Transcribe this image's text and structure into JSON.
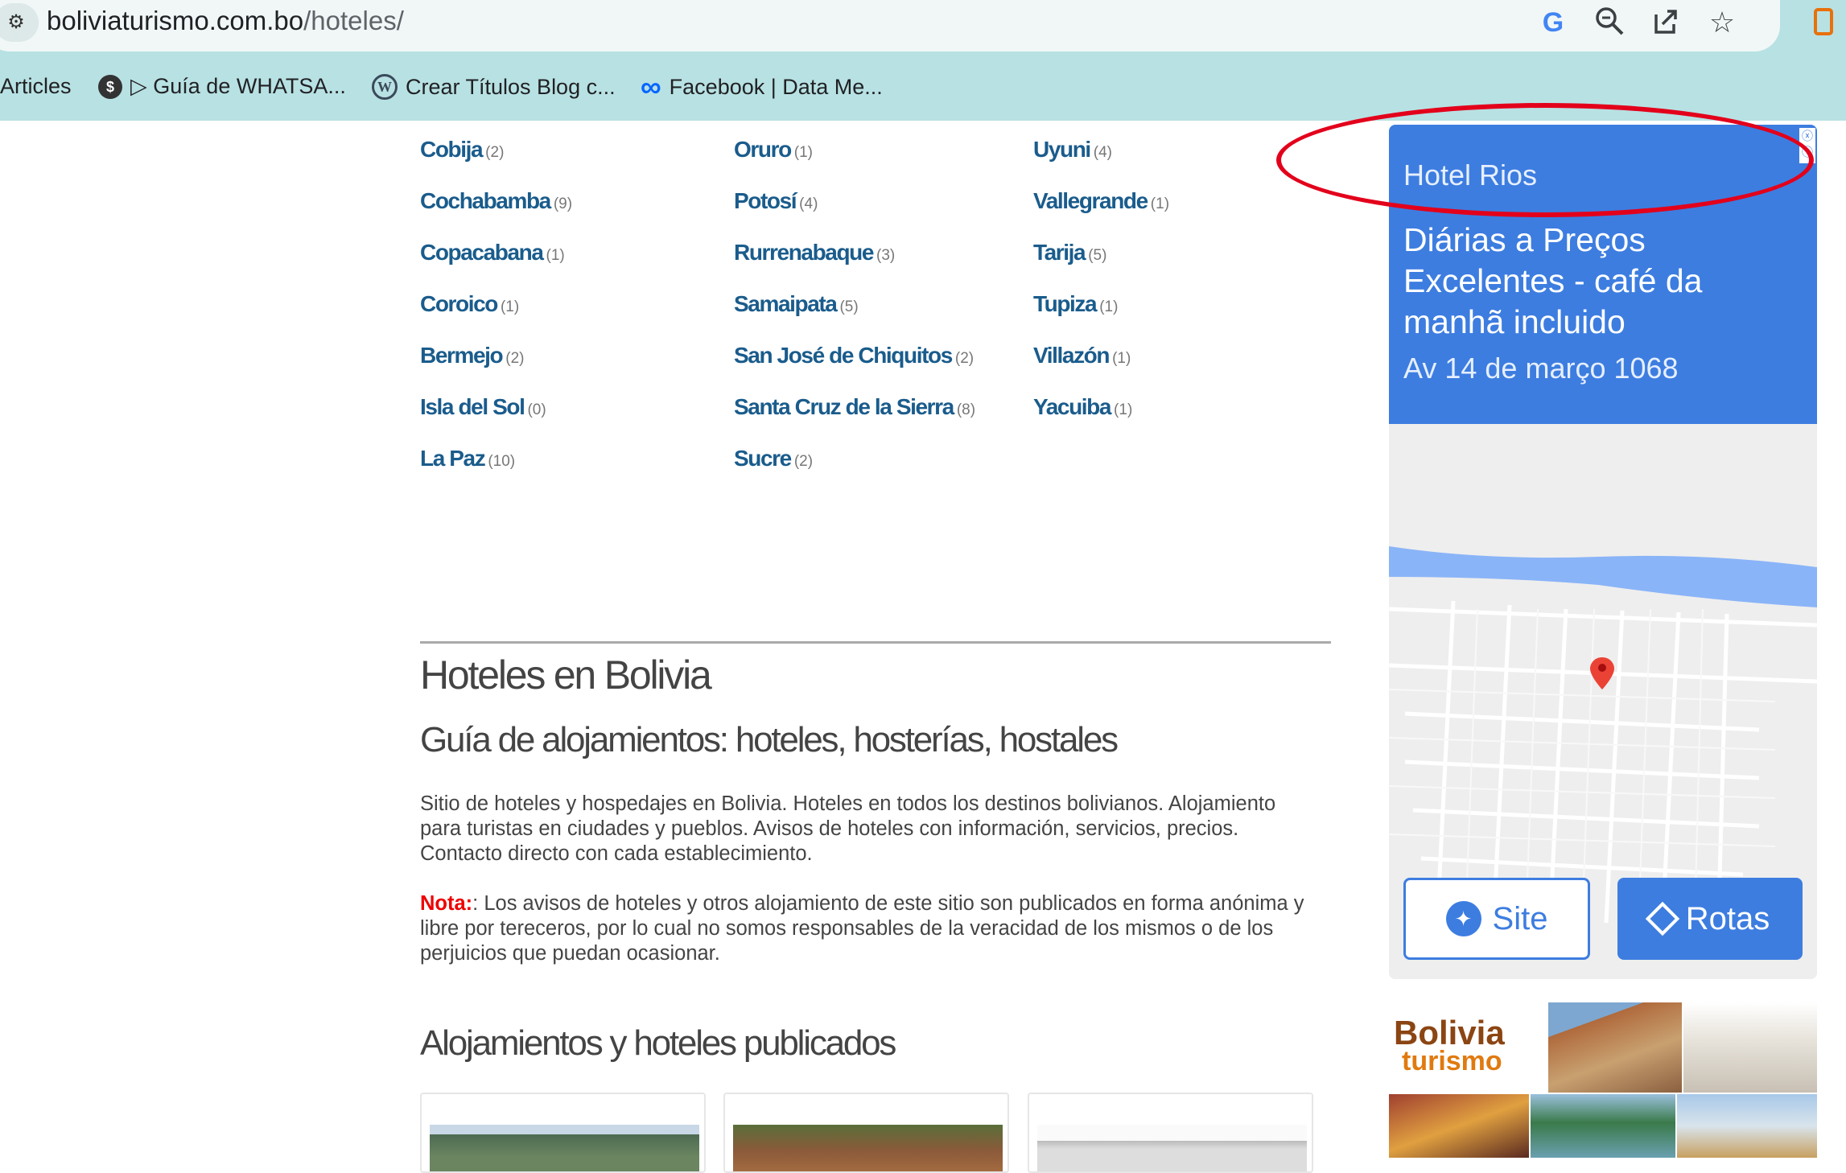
{
  "browser": {
    "url_domain": "boliviaturismo.com.bo",
    "url_path": "/hoteles/",
    "icons": [
      "site-info-icon",
      "google-icon",
      "zoom-icon",
      "share-icon",
      "star-icon",
      "extension-icon"
    ]
  },
  "bookmarks": [
    {
      "label": "Articles",
      "icon": ""
    },
    {
      "label": "▷ Guía de WHATSA...",
      "icon": "$"
    },
    {
      "label": "Crear Títulos Blog c...",
      "icon": "W"
    },
    {
      "label": "Facebook | Data Me...",
      "icon": "∞"
    }
  ],
  "destinations": {
    "col1": [
      {
        "name": "Cobija",
        "count": "(2)"
      },
      {
        "name": "Cochabamba",
        "count": "(9)"
      },
      {
        "name": "Copacabana",
        "count": "(1)"
      },
      {
        "name": "Coroico",
        "count": "(1)"
      },
      {
        "name": "Bermejo",
        "count": "(2)"
      },
      {
        "name": "Isla del Sol",
        "count": "(0)"
      },
      {
        "name": "La Paz",
        "count": "(10)"
      }
    ],
    "col2": [
      {
        "name": "Oruro",
        "count": "(1)"
      },
      {
        "name": "Potosí",
        "count": "(4)"
      },
      {
        "name": "Rurrenabaque",
        "count": "(3)"
      },
      {
        "name": "Samaipata",
        "count": "(5)"
      },
      {
        "name": "San José de Chiquitos",
        "count": "(2)"
      },
      {
        "name": "Santa Cruz de la Sierra",
        "count": "(8)"
      },
      {
        "name": "Sucre",
        "count": "(2)"
      }
    ],
    "col3": [
      {
        "name": "Uyuni",
        "count": "(4)"
      },
      {
        "name": "Vallegrande",
        "count": "(1)"
      },
      {
        "name": "Tarija",
        "count": "(5)"
      },
      {
        "name": "Tupiza",
        "count": "(1)"
      },
      {
        "name": "Villazón",
        "count": "(1)"
      },
      {
        "name": "Yacuiba",
        "count": "(1)"
      }
    ]
  },
  "main": {
    "title": "Hoteles en Bolivia",
    "subtitle": "Guía de alojamientos: hoteles, hosterías, hostales",
    "intro": "Sitio de hoteles y hospedajes en Bolivia. Hoteles en todos los destinos bolivianos. Alojamiento para turistas en ciudades y pueblos. Avisos de hoteles con información, servicios, precios. Contacto directo con cada establecimiento.",
    "nota_label": "Nota:",
    "nota_text": ": Los avisos de hoteles y otros alojamiento de este sitio son publicados en forma anónima y libre por tereceros, por lo cual no somos responsables de la veracidad de los mismos o de los perjuicios que puedan ocasionar.",
    "published_title": "Alojamientos y hoteles publicados"
  },
  "ad": {
    "name": "Hotel Rios",
    "headline": "Diárias a Preços Excelentes - café da manhã incluido",
    "address": "Av 14 de março 1068",
    "site_label": "Site",
    "rotas_label": "Rotas",
    "choices": "ⓧ ⓘ",
    "accent_color": "#3d7de0"
  },
  "banner": {
    "logo_line1": "Bolivia",
    "logo_line2": "turismo"
  },
  "annotation": {
    "color": "#e3001b",
    "shape": "ellipse around ad business name"
  }
}
